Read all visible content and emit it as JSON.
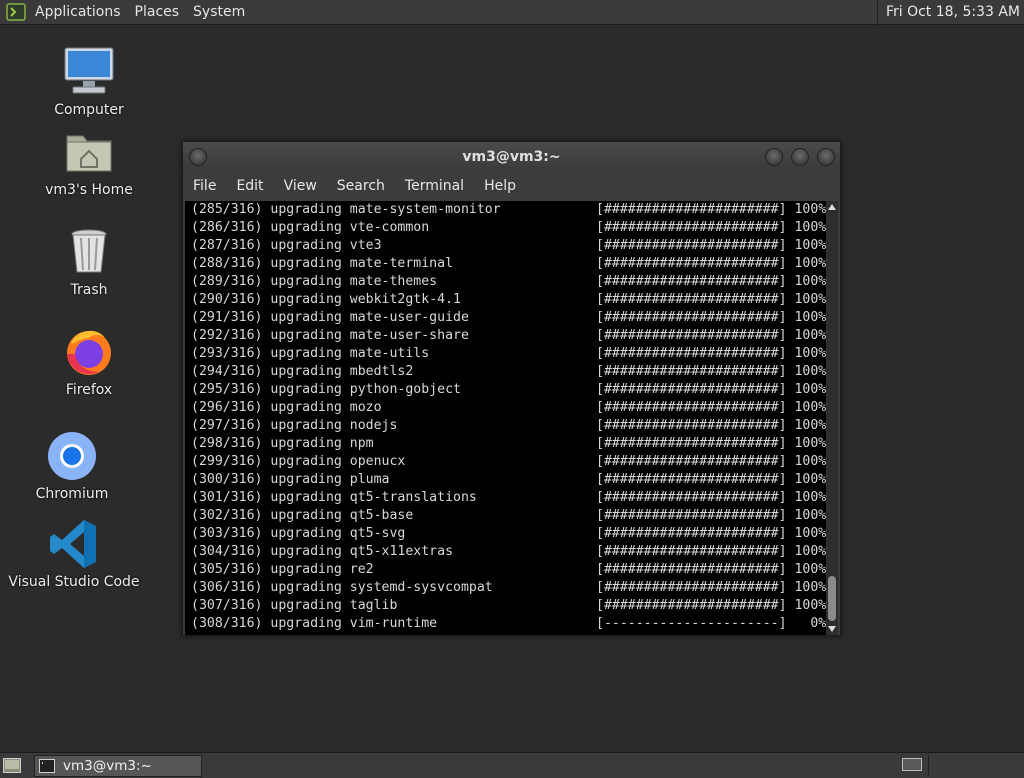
{
  "top_panel": {
    "menu": [
      "Applications",
      "Places",
      "System"
    ],
    "clock": "Fri Oct 18,  5:33 AM"
  },
  "desktop_icons": [
    {
      "label": "Computer",
      "icon": "computer-icon"
    },
    {
      "label": "vm3's Home",
      "icon": "home-folder-icon"
    },
    {
      "label": "Trash",
      "icon": "trash-icon"
    },
    {
      "label": "Firefox",
      "icon": "firefox-icon"
    },
    {
      "label": "Chromium",
      "icon": "chromium-icon"
    },
    {
      "label": "Visual Studio Code",
      "icon": "vscode-icon"
    }
  ],
  "terminal": {
    "title": "vm3@vm3:~",
    "menu": [
      "File",
      "Edit",
      "View",
      "Search",
      "Terminal",
      "Help"
    ],
    "lines": [
      {
        "text": "(285/316) upgrading mate-system-monitor",
        "progress": "[######################] 100%"
      },
      {
        "text": "(286/316) upgrading vte-common",
        "progress": "[######################] 100%"
      },
      {
        "text": "(287/316) upgrading vte3",
        "progress": "[######################] 100%"
      },
      {
        "text": "(288/316) upgrading mate-terminal",
        "progress": "[######################] 100%"
      },
      {
        "text": "(289/316) upgrading mate-themes",
        "progress": "[######################] 100%"
      },
      {
        "text": "(290/316) upgrading webkit2gtk-4.1",
        "progress": "[######################] 100%"
      },
      {
        "text": "(291/316) upgrading mate-user-guide",
        "progress": "[######################] 100%"
      },
      {
        "text": "(292/316) upgrading mate-user-share",
        "progress": "[######################] 100%"
      },
      {
        "text": "(293/316) upgrading mate-utils",
        "progress": "[######################] 100%"
      },
      {
        "text": "(294/316) upgrading mbedtls2",
        "progress": "[######################] 100%"
      },
      {
        "text": "(295/316) upgrading python-gobject",
        "progress": "[######################] 100%"
      },
      {
        "text": "(296/316) upgrading mozo",
        "progress": "[######################] 100%"
      },
      {
        "text": "(297/316) upgrading nodejs",
        "progress": "[######################] 100%"
      },
      {
        "text": "(298/316) upgrading npm",
        "progress": "[######################] 100%"
      },
      {
        "text": "(299/316) upgrading openucx",
        "progress": "[######################] 100%"
      },
      {
        "text": "(300/316) upgrading pluma",
        "progress": "[######################] 100%"
      },
      {
        "text": "(301/316) upgrading qt5-translations",
        "progress": "[######################] 100%"
      },
      {
        "text": "(302/316) upgrading qt5-base",
        "progress": "[######################] 100%"
      },
      {
        "text": "(303/316) upgrading qt5-svg",
        "progress": "[######################] 100%"
      },
      {
        "text": "(304/316) upgrading qt5-x11extras",
        "progress": "[######################] 100%"
      },
      {
        "text": "(305/316) upgrading re2",
        "progress": "[######################] 100%"
      },
      {
        "text": "(306/316) upgrading systemd-sysvcompat",
        "progress": "[######################] 100%"
      },
      {
        "text": "(307/316) upgrading taglib",
        "progress": "[######################] 100%"
      },
      {
        "text": "(308/316) upgrading vim-runtime",
        "progress": "[----------------------]   0%"
      }
    ]
  },
  "taskbar": {
    "tasks": [
      "vm3@vm3:~"
    ]
  }
}
